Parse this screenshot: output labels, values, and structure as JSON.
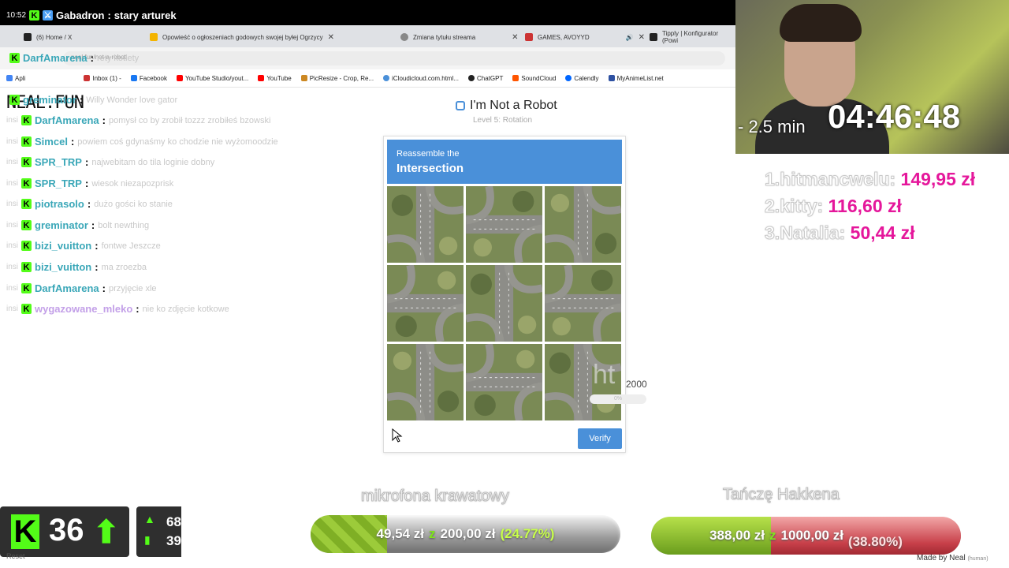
{
  "chat": {
    "top": {
      "time": "10:52",
      "user": "Gabadron",
      "msg": "stary arturek"
    },
    "lines": [
      {
        "time": "",
        "user": "DarfAmarena",
        "msg": "rety kotlety",
        "color": "#53fc18",
        "badge": "k"
      },
      {
        "time": "",
        "user": "greminator",
        "msg": "Willy Wonder love gator",
        "color": "#53fc18",
        "badge": "k"
      },
      {
        "time": "insi",
        "user": "DarfAmarena",
        "msg": "pomysł co by zrobił tozzz zrobiłeś bzowski",
        "color": "#53fc18",
        "badge": "k"
      },
      {
        "time": "insi",
        "user": "Simcel",
        "msg": "powiem coś gdynaśmy ko chodzie nie wyżomoodzie",
        "color": "#53fc18",
        "badge": "k"
      },
      {
        "time": "insi",
        "user": "SPR_TRP",
        "msg": "najwebitam do tila loginie dobny",
        "color": "#53fc18",
        "badge": "k"
      },
      {
        "time": "insi",
        "user": "SPR_TRP",
        "msg": "wiesok niezapozprisk",
        "color": "#53fc18",
        "badge": "k"
      },
      {
        "time": "insi",
        "user": "piotrasolo",
        "msg": "dużo gości ko stanie",
        "color": "#53fc18",
        "badge": "k"
      },
      {
        "time": "insi",
        "user": "greminator",
        "msg": "bolt newthing",
        "color": "#53fc18",
        "badge": "k"
      },
      {
        "time": "insi",
        "user": "bizi_vuitton",
        "msg": "fontwe Jeszcze",
        "color": "#53fc18",
        "badge": "k"
      },
      {
        "time": "insi",
        "user": "bizi_vuitton",
        "msg": "ma zroezba",
        "color": "#53fc18",
        "badge": "k"
      },
      {
        "time": "insi",
        "user": "DarfAmarena",
        "msg": "przyjęcie xle",
        "color": "#53fc18",
        "badge": "k"
      },
      {
        "time": "insi",
        "user": "wygazowane_mleko",
        "msg": "nie ko zdjęcie kotkowe",
        "color": "#53fc18",
        "badge": "k"
      }
    ]
  },
  "browser": {
    "tabs": [
      {
        "title": "(6) Home / X",
        "color": "#222"
      },
      {
        "title": "Opowieść o ogłoszeniach godowych swojej byłej Ogrzycy",
        "color": "#f4b400"
      },
      {
        "title": "Zmiana tytułu streama",
        "color": "#888"
      },
      {
        "title": "GAMES, AVOYYD",
        "color": "#c33"
      },
      {
        "title": "Tipply | Konfigurator (Powi",
        "color": "#222"
      }
    ],
    "address_text": "neal.fun/not-a-robot",
    "bookmarks": [
      {
        "label": "Apli",
        "color": "#4285f4"
      },
      {
        "label": "Inbox (1) -",
        "color": "#c33"
      },
      {
        "label": "Facebook",
        "color": "#1877f2"
      },
      {
        "label": "YouTube Studio/yout...",
        "color": "#f00"
      },
      {
        "label": "YouTube",
        "color": "#f00"
      },
      {
        "label": "PicResize - Crop, Re...",
        "color": "#c82"
      },
      {
        "label": "iCloudicloud.com.html...",
        "color": "#4a90d9"
      },
      {
        "label": "ChatGPT",
        "color": "#222"
      },
      {
        "label": "SoundCloud",
        "color": "#f50"
      },
      {
        "label": "Calendly",
        "color": "#06f"
      },
      {
        "label": "MyAnimeList.net",
        "color": "#2e51a2"
      }
    ]
  },
  "site": {
    "logo": "NEAL.FUN"
  },
  "captcha": {
    "title": "I'm Not a Robot",
    "subtitle": "Level 5: Rotation",
    "prompt": "Reassemble the",
    "target": "Intersection",
    "verify_label": "Verify"
  },
  "overlay_ghost": {
    "number": "2000",
    "bar": "0%",
    "text": "ht"
  },
  "stream": {
    "timer": "04:46:48",
    "minutes": "- 2.5 min",
    "top_donors": [
      {
        "rank": "1.",
        "name": "hitmancwelu:",
        "amount": "149,95 zł"
      },
      {
        "rank": "2.",
        "name": "kitty:",
        "amount": "116,60 zł"
      },
      {
        "rank": "3.",
        "name": "Natalia:",
        "amount": "50,44 zł"
      }
    ],
    "kick_followers": "36",
    "kick_stats": [
      "68",
      "39"
    ],
    "reset_label": "Reset",
    "goals": [
      {
        "label": "mikrofona krawatowy",
        "current": "49,54 zł",
        "z": "z",
        "target": "200,00 zł",
        "percent_text": "(24.77%)",
        "percent": 24.77
      },
      {
        "label": "Tańczę Hakkena",
        "current": "388,00 zł",
        "z": "z",
        "target": "1000,00 zł",
        "percent_text": "(38.80%)",
        "percent": 38.8
      }
    ],
    "madeby": "Made by Neal",
    "madeby_small": "(human)"
  }
}
